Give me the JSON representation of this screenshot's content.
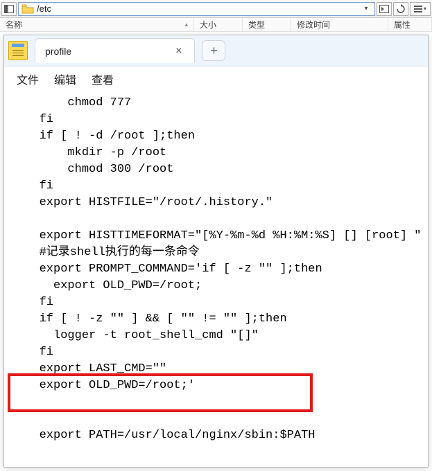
{
  "toolbar": {
    "path": "/etc"
  },
  "columns": {
    "name": "名称",
    "size": "大小",
    "type": "类型",
    "modified": "修改时间",
    "attr": "属性"
  },
  "editor": {
    "tab_title": "profile",
    "menu": {
      "file": "文件",
      "edit": "编辑",
      "view": "查看"
    },
    "lines": [
      "       chmod 777",
      "   fi",
      "   if [ ! -d /root ];then",
      "       mkdir -p /root",
      "       chmod 300 /root",
      "   fi",
      "   export HISTFILE=\"/root/.history.\"",
      "",
      "   export HISTTIMEFORMAT=\"[%Y-%m-%d %H:%M:%S] [] [root] \"",
      "   #记录shell执行的每一条命令",
      "   export PROMPT_COMMAND='if [ -z \"\" ];then",
      "     export OLD_PWD=/root;",
      "   fi",
      "   if [ ! -z \"\" ] && [ \"\" != \"\" ];then",
      "     logger -t root_shell_cmd \"[]\"",
      "   fi",
      "   export LAST_CMD=\"\"",
      "   export OLD_PWD=/root;'",
      "",
      "",
      "   export PATH=/usr/local/nginx/sbin:$PATH"
    ]
  }
}
